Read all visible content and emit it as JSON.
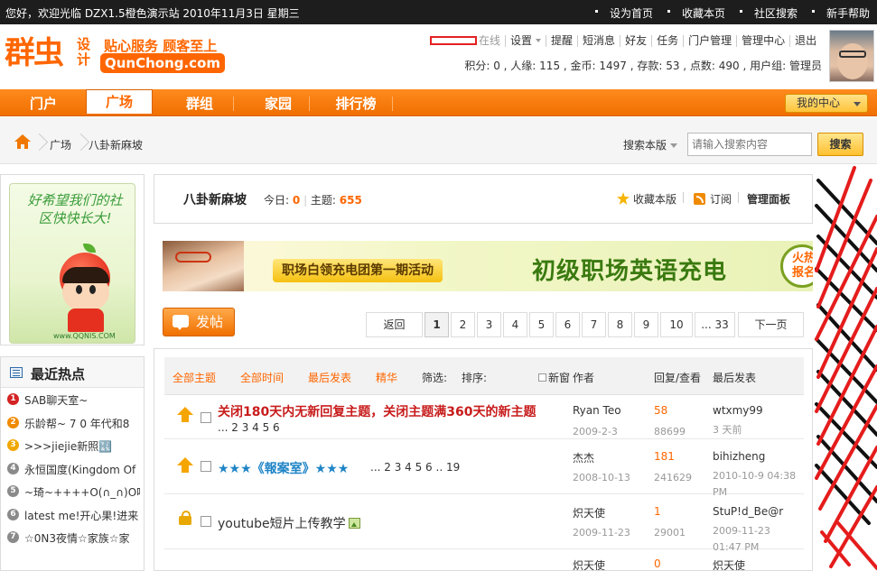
{
  "topbar": {
    "welcome": "您好，欢迎光临 DZX1.5橙色演示站 2010年11月3日 星期三",
    "links": [
      "设为首页",
      "收藏本页",
      "社区搜索",
      "新手帮助"
    ]
  },
  "logo": {
    "cn": "群虫",
    "sheji": "设计",
    "slogan": "贴心服务 顾客至上",
    "domain": "QunChong.com"
  },
  "user": {
    "status": "在线",
    "menu": [
      "设置",
      "提醒",
      "短消息",
      "好友",
      "任务",
      "门户管理",
      "管理中心",
      "退出"
    ],
    "stats": "积分: 0 , 人缘: 115 , 金币: 1497 , 存款: 53 , 点数: 490 , 用户组: 管理员"
  },
  "nav": {
    "tabs": [
      "门户",
      "广场",
      "群组",
      "家园",
      "排行榜"
    ],
    "active_index": 1,
    "my_center": "我的中心"
  },
  "breadcrumb": {
    "items": [
      "广场",
      "八卦新麻坡"
    ]
  },
  "search": {
    "scope_label": "搜索本版",
    "placeholder": "请输入搜索内容",
    "button": "搜索"
  },
  "sidebar": {
    "promo_text": "好希望我们的社区快快长大!",
    "promo_site": "www.QQNIS.COM",
    "hot_title": "最近热点",
    "hot_items": [
      {
        "num": "1",
        "label": "SAB聊天室~",
        "color": "#d42222"
      },
      {
        "num": "2",
        "label": "乐龄帮~ 7 0 年代和8",
        "color": "#f08a00"
      },
      {
        "num": "3",
        "label": ">>>jiejie新照🔣",
        "color": "#f0a800"
      },
      {
        "num": "4",
        "label": "永恒国度(Kingdom Of",
        "color": "#8a8a8a"
      },
      {
        "num": "5",
        "label": "~琦~++++O(∩_∩)O哈",
        "color": "#8a8a8a"
      },
      {
        "num": "6",
        "label": "latest me!开心果!进来",
        "color": "#8a8a8a"
      },
      {
        "num": "7",
        "label": "☆0N3夜情☆家族☆家",
        "color": "#8a8a8a"
      }
    ]
  },
  "forum": {
    "name": "八卦新麻坡",
    "today_label": "今日:",
    "today_value": "0",
    "topics_label": "主题:",
    "topics_value": "655",
    "favorite": "收藏本版",
    "rss": "订阅",
    "admin": "管理面板"
  },
  "banner": {
    "tag": "职场白领充电团第一期活动",
    "headline": "初级职场英语充电",
    "side": "火热报名"
  },
  "post_button": "发帖",
  "pagination": {
    "prev": "返回",
    "pages": [
      "1",
      "2",
      "3",
      "4",
      "5",
      "6",
      "7",
      "8",
      "9",
      "10",
      "... 33"
    ],
    "current": "1",
    "next": "下一页"
  },
  "thread_list": {
    "filters": [
      "全部主题",
      "全部时间",
      "最后发表",
      "精华"
    ],
    "filter_label": "筛选:",
    "sort_label": "排序:",
    "newwin_label": "新窗",
    "columns": [
      "作者",
      "回复/查看",
      "最后发表"
    ],
    "threads": [
      {
        "title": "关闭180天内无新回复主题，关闭主题满360天的新主题",
        "pages": "... 2 3 4 5 6",
        "author": "Ryan Teo",
        "date": "2009-2-3",
        "replies": "58",
        "views": "88699",
        "last_user": "wtxmy99",
        "last_time": "3 天前",
        "color": "#c81c1c"
      },
      {
        "title": "★★★《報案室》★★★",
        "pages": "... 2 3 4 5 6 .. 19",
        "author": "杰杰",
        "date": "2008-10-13",
        "replies": "181",
        "views": "241629",
        "last_user": "bihizheng",
        "last_time": "2010-10-9 04:38 PM",
        "color": "#1f84c6"
      },
      {
        "title": "youtube短片上传教学",
        "pages": "",
        "author": "炽天使",
        "date": "2009-11-23",
        "replies": "1",
        "views": "29001",
        "last_user": "StuP!d_Be@r",
        "last_time": "2009-11-23 01:47 PM",
        "color": "#333333"
      },
      {
        "title": "",
        "pages": "",
        "author": "炽天使",
        "date": "",
        "replies": "0",
        "views": "",
        "last_user": "炽天使",
        "last_time": "",
        "color": "#333333"
      }
    ]
  }
}
